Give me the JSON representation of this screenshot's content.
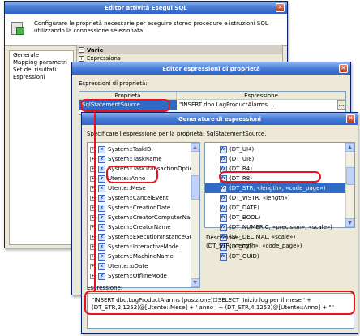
{
  "sql_task_editor": {
    "title": "Editor attività Esegui SQL",
    "description": "Configurare le proprietà necessarie per eseguire stored procedure e istruzioni SQL utilizzando la connessione selezionata.",
    "nav": [
      "Generale",
      "Mapping parametri",
      "Set dei risultati",
      "Espressioni"
    ],
    "group_label": "Varie",
    "group_item": "Expressions"
  },
  "property_expressions": {
    "title": "Editor espressioni di proprietà",
    "label": "Espressioni di proprietà:",
    "col_property": "Proprietà",
    "col_expression": "Espressione",
    "row_property": "SqlStatementSource",
    "row_expression": "\"INSERT dbo.LogProductAlarms ...",
    "ellipsis": "..."
  },
  "expression_builder": {
    "title": "Generatore di espressioni",
    "prompt": "Specificare l'espressione per la proprietà: SqlStatementSource.",
    "variables": [
      "System::TaskID",
      "System::TaskName",
      "System::TaskTransactionOptio",
      "Utente::Anno",
      "Utente::Mese",
      "System::CancelEvent",
      "System::CreationDate",
      "System::CreatorComputerNam",
      "System::CreatorName",
      "System::ExecutionInstanceGUI",
      "System::InteractiveMode",
      "System::MachineName",
      "Utente::oDate",
      "System::OfflineMode"
    ],
    "functions": [
      "(DT_UI4)",
      "(DT_UI8)",
      "(DT_R4)",
      "(DT_R8)",
      "(DT_STR, «length», «code_page»)",
      "(DT_WSTR, «length»)",
      "(DT_DATE)",
      "(DT_BOOL)",
      "(DT_NUMERIC, «precision», «scale»)",
      "(DT_DECIMAL, «scale»)",
      "(DT_CY)",
      "(DT_GUID)"
    ],
    "description_label": "Descrizione:",
    "description_text": "(DT_STR, «length», «code_page»)",
    "expression_label": "Espressione:",
    "expression_line1": "\"INSERT dbo.LogProductAlarms (posizione)☐SELECT 'Inizio log per il mese ' +",
    "expression_line2": "(DT_STR,2,1252)@[Utente::Mese] + ' anno ' + (DT_STR,4,1252)@[Utente::Anno] + \"\""
  },
  "colors": {
    "highlight_red": "#e8131f",
    "title_blue": "#2f62c8",
    "selection_blue": "#316ac5"
  }
}
